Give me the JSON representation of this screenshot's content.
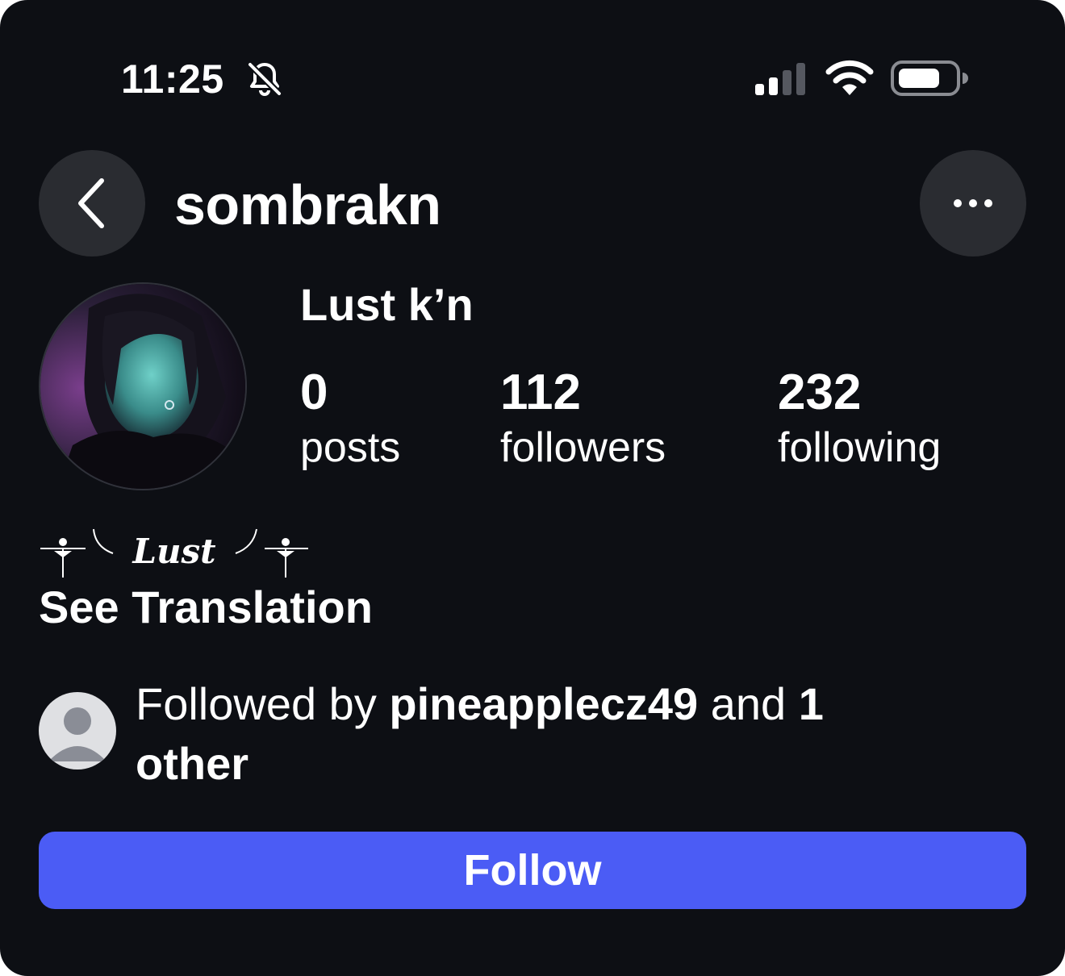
{
  "status_bar": {
    "time": "11:25",
    "mute_icon": "bell-slash-icon",
    "signal_icon": "cellular-signal-icon",
    "wifi_icon": "wifi-icon",
    "battery_icon": "battery-icon"
  },
  "header": {
    "back_icon": "chevron-left-icon",
    "username": "sombrakn",
    "more_icon": "ellipsis-icon"
  },
  "profile": {
    "display_name": "Lust k’n",
    "stats": [
      {
        "value": "0",
        "label": "posts"
      },
      {
        "value": "112",
        "label": "followers"
      },
      {
        "value": "232",
        "label": "following"
      }
    ],
    "bio": "Lust",
    "see_translation": "See Translation"
  },
  "followed_by": {
    "prefix": "Followed by ",
    "user": "pineapplecz49",
    "middle": " and ",
    "count": "1",
    "suffix": " other"
  },
  "follow_button": {
    "label": "Follow",
    "color": "#4b5cf5"
  },
  "colors": {
    "background": "#0d0f14",
    "button_gray": "#2a2c31"
  }
}
